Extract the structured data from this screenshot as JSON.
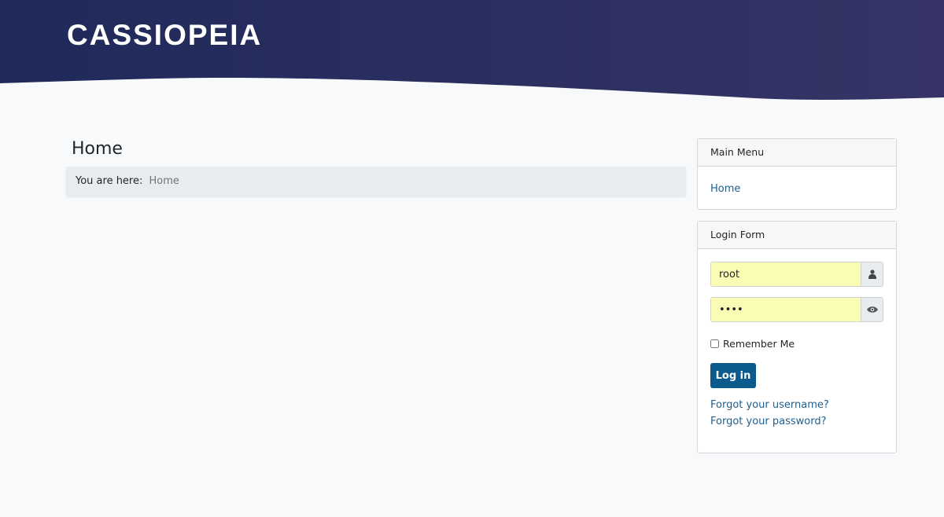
{
  "header": {
    "logo": "CASSIOPEIA",
    "gradient": [
      "#1f2a5a",
      "#363466"
    ]
  },
  "main": {
    "title": "Home",
    "breadcrumb": {
      "prefix": "You are here:",
      "current": "Home"
    }
  },
  "main_menu": {
    "title": "Main Menu",
    "items": [
      {
        "label": "Home"
      }
    ]
  },
  "login": {
    "title": "Login Form",
    "username": "root",
    "password": "••••",
    "remember": "Remember Me",
    "remember_checked": false,
    "submit": "Log in",
    "forgot_username": "Forgot your username?",
    "forgot_password": "Forgot your password?",
    "user_icon": "user-icon",
    "eye_icon": "eye-icon"
  }
}
